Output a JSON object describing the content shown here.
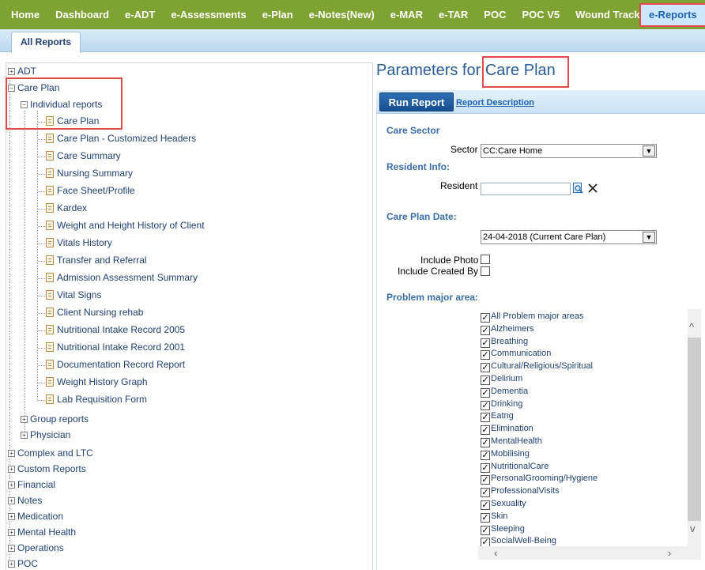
{
  "nav": {
    "items": [
      "Home",
      "Dashboard",
      "e-ADT",
      "e-Assessments",
      "e-Plan",
      "e-Notes(New)",
      "e-MAR",
      "e-TAR",
      "POC",
      "POC V5",
      "Wound Tracker"
    ],
    "active": "e-Reports"
  },
  "tabs": {
    "all_reports": "All Reports"
  },
  "tree": {
    "adt": "ADT",
    "care_plan": "Care Plan",
    "individual_reports": "Individual reports",
    "reports": [
      "Care Plan",
      "Care Plan - Customized Headers",
      "Care Summary",
      "Nursing Summary",
      "Face Sheet/Profile",
      "Kardex",
      "Weight and Height History of Client",
      "Vitals History",
      "Transfer and Referral",
      "Admission Assessment Summary",
      "Vital Signs",
      "Client Nursing rehab",
      "Nutritional Intake Record 2005",
      "Nutritional Intake Record 2001",
      "Documentation Record Report",
      "Weight History Graph",
      "Lab Requisition Form"
    ],
    "group_reports": "Group reports",
    "physician": "Physician",
    "top_items": [
      "Complex and LTC",
      "Custom Reports",
      "Financial",
      "Notes",
      "Medication",
      "Mental Health",
      "Operations",
      "POC"
    ]
  },
  "params": {
    "title_prefix": "Parameters for",
    "title_report": "Care Plan",
    "run_report": "Run Report",
    "report_description": "Report Description",
    "care_sector_heading": "Care Sector",
    "sector_label": "Sector",
    "sector_value": "CC:Care Home",
    "resident_info_heading": "Resident Info:",
    "resident_label": "Resident",
    "resident_value": "",
    "care_plan_date_heading": "Care Plan Date:",
    "care_plan_date_value": "24-04-2018 (Current Care Plan)",
    "include_photo": "Include Photo",
    "include_created_by": "Include Created By",
    "problem_area_heading": "Problem major area:",
    "problem_areas": [
      "All Problem major areas",
      "Alzheimers",
      "Breathing",
      "Communication",
      "Cultural/Religious/Spiritual",
      "Delirium",
      "Dementia",
      "Drinking",
      "Eatng",
      "Elimination",
      "MentalHealth",
      "Mobilising",
      "NutritionalCare",
      "PersonalGrooming/Hygiene",
      "ProfessionalVisits",
      "Sexuality",
      "Skin",
      "Sleeping",
      "SocialWell-Being"
    ]
  },
  "colors": {
    "nav_bg": "#7fa332",
    "highlight": "#e34b4b",
    "link": "#1d63b8"
  }
}
